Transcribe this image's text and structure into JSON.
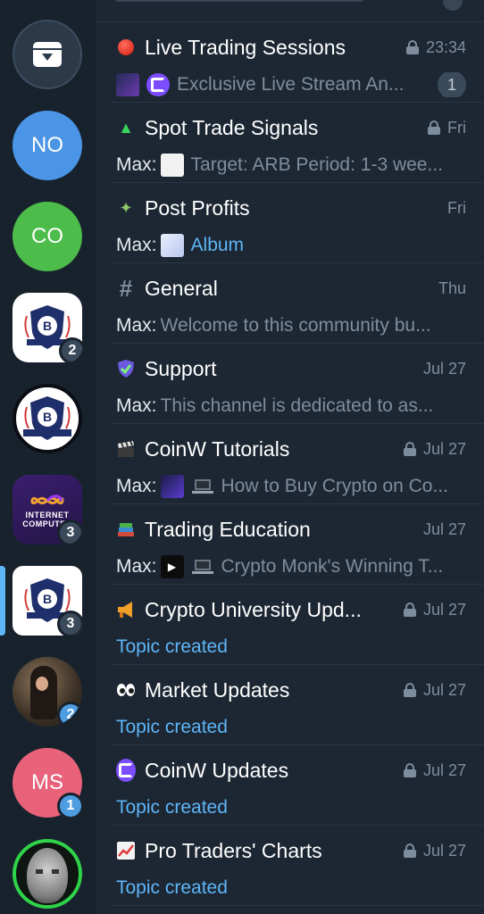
{
  "folders": [
    {
      "type": "archive",
      "icon": "archive-icon"
    },
    {
      "type": "letter",
      "label": "NO",
      "color": "#4a95e6"
    },
    {
      "type": "letter",
      "label": "CO",
      "color": "#4cbc4a"
    },
    {
      "type": "crypto",
      "badge": "2"
    },
    {
      "type": "crypto"
    },
    {
      "type": "icp",
      "label": "INTERNET COMPUTER",
      "badge": "3"
    },
    {
      "type": "crypto",
      "badge": "3",
      "active": true
    },
    {
      "type": "photo",
      "badge": "2"
    },
    {
      "type": "letter",
      "label": "MS",
      "color": "#e8627a",
      "badge": "1"
    },
    {
      "type": "face"
    }
  ],
  "chats": [
    {
      "icon": "red-circle-icon",
      "title": "Live Trading Sessions",
      "locked": true,
      "time": "23:34",
      "sender": "",
      "preview": "Exclusive Live Stream An...",
      "unread": "1"
    },
    {
      "icon": "tree-icon",
      "title": "Spot Trade Signals",
      "locked": true,
      "time": "Fri",
      "sender": "Max:",
      "preview": "Target: ARB Period: 1-3 wee..."
    },
    {
      "icon": "money-wings-icon",
      "title": "Post Profits",
      "locked": false,
      "time": "Fri",
      "sender": "Max:",
      "preview": "Album"
    },
    {
      "icon": "hash-icon",
      "title": "General",
      "locked": false,
      "time": "Thu",
      "sender": "Max:",
      "preview": "Welcome to this community bu..."
    },
    {
      "icon": "shield-check-icon",
      "title": "Support",
      "locked": false,
      "time": "Jul 27",
      "sender": "Max:",
      "preview": "This channel is dedicated to as..."
    },
    {
      "icon": "clapper-icon",
      "title": "CoinW Tutorials",
      "locked": true,
      "time": "Jul 27",
      "sender": "Max:",
      "preview": "How to Buy Crypto on Co..."
    },
    {
      "icon": "books-icon",
      "title": "Trading Education",
      "locked": false,
      "time": "Jul 27",
      "sender": "Max:",
      "preview": "Crypto Monk's Winning T..."
    },
    {
      "icon": "megaphone-icon",
      "title": "Crypto University Upd...",
      "locked": true,
      "time": "Jul 27",
      "sender": "",
      "preview": "Topic created"
    },
    {
      "icon": "eyes-icon",
      "title": "Market Updates",
      "locked": true,
      "time": "Jul 27",
      "sender": "",
      "preview": "Topic created"
    },
    {
      "icon": "coinw-icon",
      "title": "CoinW Updates",
      "locked": true,
      "time": "Jul 27",
      "sender": "",
      "preview": "Topic created"
    },
    {
      "icon": "chart-up-icon",
      "title": "Pro Traders' Charts",
      "locked": true,
      "time": "Jul 27",
      "sender": "",
      "preview": "Topic created"
    }
  ],
  "colors": {
    "link": "#5eb5f7",
    "muted": "#7e8d9d",
    "sidebar": "#18222d",
    "list": "#1d2733"
  }
}
